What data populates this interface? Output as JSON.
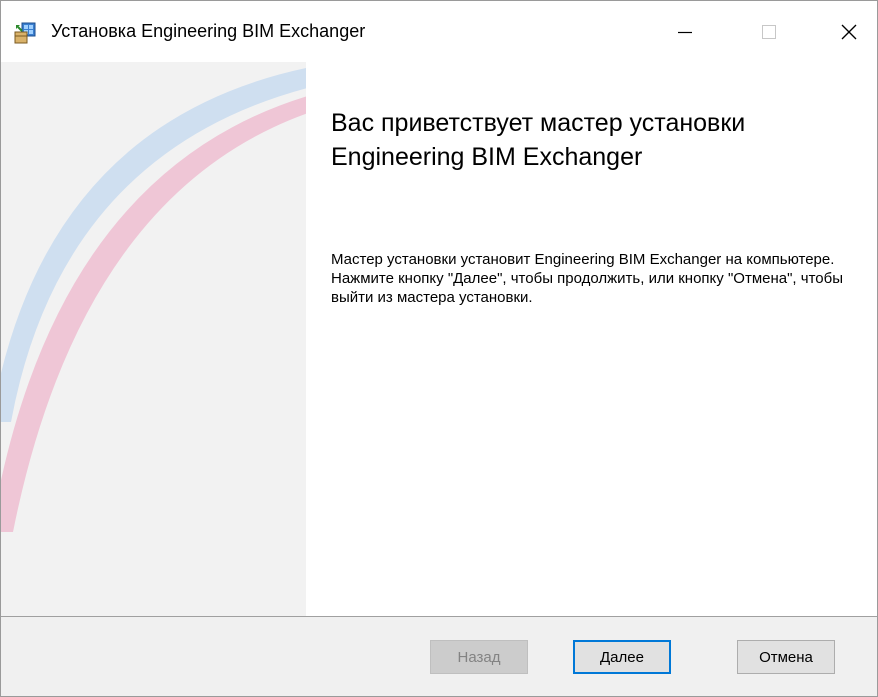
{
  "window": {
    "title": "Установка Engineering BIM Exchanger"
  },
  "titlebar": {
    "icons": [
      "installer-app-icon",
      "minimize-icon",
      "maximize-icon",
      "close-icon"
    ]
  },
  "main": {
    "welcome_title": "Вас приветствует мастер установки Engineering BIM Exchanger",
    "welcome_description": "Мастер установки установит Engineering BIM Exchanger на компьютере. Нажмите кнопку \"Далее\", чтобы продолжить, или кнопку \"Отмена\", чтобы выйти из мастера установки."
  },
  "banner": {
    "arc_colors": [
      "#cfdff0",
      "#efc6d6"
    ],
    "background_color": "#f2f2f2"
  },
  "footer": {
    "back_label": "Назад",
    "back_enabled": false,
    "next_label": "Далее",
    "next_focused": true,
    "cancel_label": "Отмена",
    "focus_color": "#0078d7"
  }
}
